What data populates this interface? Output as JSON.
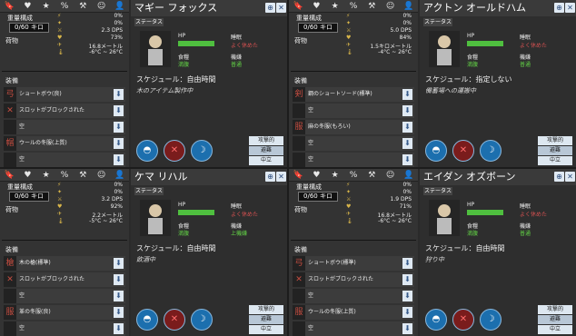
{
  "tabs": [
    "🔖",
    "♥",
    "★",
    "%",
    "⚒",
    "☺",
    "👤"
  ],
  "labels": {
    "weight": "重量構成",
    "cargo": "荷物",
    "equipment": "装備",
    "status": "ステータス",
    "hp": "HP",
    "sleep": "睡眠",
    "food": "食糧",
    "thirst": "機嫌",
    "schedule": "スケジュール：",
    "stance_attack": "攻撃的",
    "stance_evade": "避難",
    "stance_neutral": "中立"
  },
  "panels": [
    {
      "weight": "0/60 キロ",
      "name": "マギー フォックス",
      "stats": [
        [
          "⚡",
          "0%"
        ],
        [
          "✦",
          "0%"
        ],
        [
          "⚔",
          "2.3 DPS"
        ],
        [
          "♥",
          "73%"
        ],
        [
          "✈",
          "16.8メートル"
        ],
        [
          "🌡",
          "-6°C ~ 26°C"
        ]
      ],
      "sleep": "よく休めた",
      "food": "満腹",
      "thirst": "普通",
      "schedule": "自由時間",
      "activity": "木のアイテム製作中",
      "equip": [
        [
          "弓",
          "ショートボウ(良)"
        ],
        [
          "✕",
          "スロットがブロックされた"
        ],
        [
          "",
          "空"
        ],
        [
          "帽",
          "ウールの冬服(上質)"
        ],
        [
          "",
          "空"
        ]
      ]
    },
    {
      "weight": "0/60 キロ",
      "name": "アクトン オールドハム",
      "stats": [
        [
          "⚡",
          "0%"
        ],
        [
          "✦",
          "0%"
        ],
        [
          "⚔",
          "5.0 DPS"
        ],
        [
          "♥",
          "84%"
        ],
        [
          "✈",
          "1.5キロメートル"
        ],
        [
          "🌡",
          "-4°C ~ 26°C"
        ]
      ],
      "sleep": "よく休めた",
      "food": "満腹",
      "thirst": "普通",
      "schedule": "指定しない",
      "activity": "備蓄場への運搬中",
      "equip": [
        [
          "剣",
          "鋼のショートソード(標準)"
        ],
        [
          "",
          "空"
        ],
        [
          "服",
          "麻の冬服(もろい)"
        ],
        [
          "",
          "空"
        ],
        [
          "",
          "空"
        ]
      ]
    },
    {
      "weight": "0/60 キロ",
      "name": "ケマ リハル",
      "stats": [
        [
          "⚡",
          "0%"
        ],
        [
          "✦",
          "0%"
        ],
        [
          "⚔",
          "3.2 DPS"
        ],
        [
          "♥",
          "92%"
        ],
        [
          "✈",
          "2.2メートル"
        ],
        [
          "🌡",
          "-5°C ~ 26°C"
        ]
      ],
      "sleep": "よく休めた",
      "food": "満腹",
      "thirst": "上機嫌",
      "schedule": "自由時間",
      "activity": "飲酒中",
      "equip": [
        [
          "槍",
          "木の槍(標準)"
        ],
        [
          "✕",
          "スロットがブロックされた"
        ],
        [
          "",
          "空"
        ],
        [
          "服",
          "革の冬服(良)"
        ],
        [
          "",
          "空"
        ]
      ]
    },
    {
      "weight": "0/60 キロ",
      "name": "エイダン オズボーン",
      "stats": [
        [
          "⚡",
          "0%"
        ],
        [
          "✦",
          "0%"
        ],
        [
          "⚔",
          "1.9 DPS"
        ],
        [
          "♥",
          "71%"
        ],
        [
          "✈",
          "16.8メートル"
        ],
        [
          "🌡",
          "-6°C ~ 26°C"
        ]
      ],
      "sleep": "よく休めた",
      "food": "満腹",
      "thirst": "普通",
      "schedule": "自由時間",
      "activity": "狩り中",
      "equip": [
        [
          "弓",
          "ショートボウ(標準)"
        ],
        [
          "✕",
          "スロットがブロックされた"
        ],
        [
          "",
          "空"
        ],
        [
          "服",
          "ウールの冬服(上質)"
        ],
        [
          "",
          "空"
        ]
      ]
    }
  ]
}
